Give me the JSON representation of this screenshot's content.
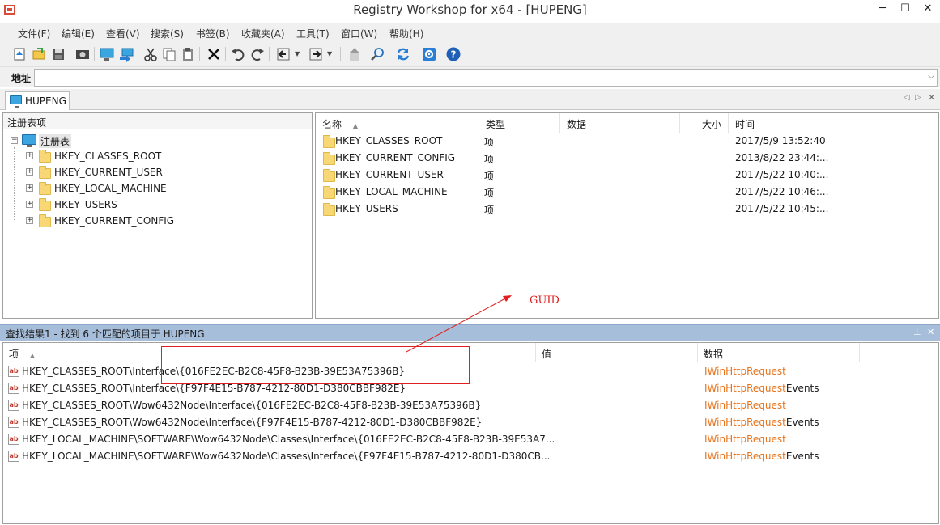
{
  "window": {
    "title": "Registry Workshop for x64 - [HUPENG]",
    "min": "─",
    "max": "☐",
    "close": "✕"
  },
  "menu": [
    "文件(F)",
    "编辑(E)",
    "查看(V)",
    "搜索(S)",
    "书签(B)",
    "收藏夹(A)",
    "工具(T)",
    "窗口(W)",
    "帮助(H)"
  ],
  "address": {
    "label": "地址",
    "value": ""
  },
  "tab": {
    "label": "HUPENG"
  },
  "left_pane": {
    "header": "注册表项",
    "root": "注册表",
    "hives": [
      "HKEY_CLASSES_ROOT",
      "HKEY_CURRENT_USER",
      "HKEY_LOCAL_MACHINE",
      "HKEY_USERS",
      "HKEY_CURRENT_CONFIG"
    ]
  },
  "right_pane": {
    "columns": {
      "name": "名称",
      "type": "类型",
      "data": "数据",
      "size": "大小",
      "time": "时间"
    },
    "rows": [
      {
        "name": "HKEY_CLASSES_ROOT",
        "type": "项",
        "time": "2017/5/9 13:52:40"
      },
      {
        "name": "HKEY_CURRENT_CONFIG",
        "type": "项",
        "time": "2013/8/22 23:44:..."
      },
      {
        "name": "HKEY_CURRENT_USER",
        "type": "项",
        "time": "2017/5/22 10:40:..."
      },
      {
        "name": "HKEY_LOCAL_MACHINE",
        "type": "项",
        "time": "2017/5/22 10:46:..."
      },
      {
        "name": "HKEY_USERS",
        "type": "项",
        "time": "2017/5/22 10:45:..."
      }
    ]
  },
  "search": {
    "title": "查找结果1 - 找到 6 个匹配的项目于 HUPENG",
    "columns": {
      "item": "项",
      "value": "值",
      "data": "数据"
    },
    "rows": [
      {
        "item": "HKEY_CLASSES_ROOT\\Interface\\{016FE2EC-B2C8-45F8-B23B-39E53A75396B}",
        "data_hl": "IWinHttpRequest",
        "data_rest": ""
      },
      {
        "item": "HKEY_CLASSES_ROOT\\Interface\\{F97F4E15-B787-4212-80D1-D380CBBF982E}",
        "data_hl": "IWinHttpRequest",
        "data_rest": "Events"
      },
      {
        "item": "HKEY_CLASSES_ROOT\\Wow6432Node\\Interface\\{016FE2EC-B2C8-45F8-B23B-39E53A75396B}",
        "data_hl": "IWinHttpRequest",
        "data_rest": ""
      },
      {
        "item": "HKEY_CLASSES_ROOT\\Wow6432Node\\Interface\\{F97F4E15-B787-4212-80D1-D380CBBF982E}",
        "data_hl": "IWinHttpRequest",
        "data_rest": "Events"
      },
      {
        "item": "HKEY_LOCAL_MACHINE\\SOFTWARE\\Wow6432Node\\Classes\\Interface\\{016FE2EC-B2C8-45F8-B23B-39E53A7...",
        "data_hl": "IWinHttpRequest",
        "data_rest": ""
      },
      {
        "item": "HKEY_LOCAL_MACHINE\\SOFTWARE\\Wow6432Node\\Classes\\Interface\\{F97F4E15-B787-4212-80D1-D380CB...",
        "data_hl": "IWinHttpRequest",
        "data_rest": "Events"
      }
    ]
  },
  "annotation": {
    "text": "GUID",
    "color": "#e02020"
  },
  "colors": {
    "search_bar": "#a6bed9",
    "highlight": "#e8731b",
    "folder": "#f8d775"
  }
}
